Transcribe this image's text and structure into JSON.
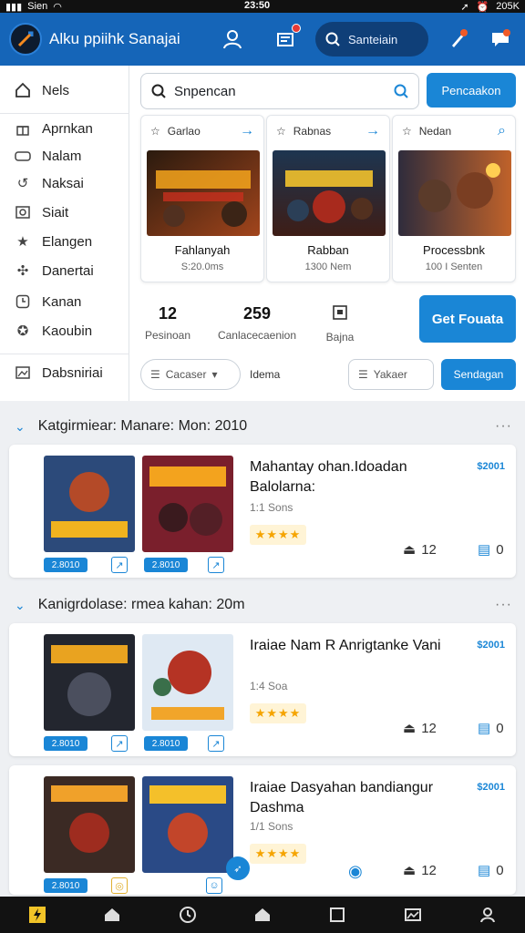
{
  "status": {
    "carrier": "Sien",
    "time": "23:50",
    "battery": "205K"
  },
  "header": {
    "title": "Alku ppiihk Sanajai",
    "search_label": "Santeiain"
  },
  "sidebar": {
    "items": [
      {
        "label": "Nels",
        "icon": "home-icon"
      },
      {
        "label": "Aprnkan",
        "icon": "gift-icon"
      },
      {
        "label": "Nalam",
        "icon": "controller-icon"
      },
      {
        "label": "Naksai",
        "icon": "refresh-icon"
      },
      {
        "label": "Siait",
        "icon": "photo-icon"
      },
      {
        "label": "Elangen",
        "icon": "star-icon"
      },
      {
        "label": "Danertai",
        "icon": "puzzle-icon"
      },
      {
        "label": "Kanan",
        "icon": "clock-icon"
      },
      {
        "label": "Kaoubin",
        "icon": "badge-icon"
      },
      {
        "label": "Dabsniriai",
        "icon": "image-icon"
      }
    ]
  },
  "search": {
    "value": "Snpencan",
    "button": "Pencaakon"
  },
  "featured": [
    {
      "head": "Garlao",
      "name": "Fahlanyah",
      "sub": "S:20.0ms",
      "icon": "arrow-right-icon"
    },
    {
      "head": "Rabnas",
      "name": "Rabban",
      "sub": "1300 Nem",
      "icon": "arrow-right-icon"
    },
    {
      "head": "Nedan",
      "name": "Processbnk",
      "sub": "100 I Senten",
      "icon": "search-icon"
    }
  ],
  "stats": [
    {
      "value": "12",
      "label": "Pesinoan"
    },
    {
      "value": "259",
      "label": "Canlacecaenion"
    },
    {
      "value": "",
      "label": "Bajna"
    }
  ],
  "get_button": "Get Fouata",
  "filters": {
    "sort": "Cacaser",
    "plain": "Idema",
    "view": "Yakaer",
    "blue": "Sendagan"
  },
  "sections": [
    {
      "title": "Katgirmiear: Manare: Mon: 2010",
      "more": "···"
    },
    {
      "title": "Kanigrdolase: rmea kahan: 20m",
      "more": "···"
    }
  ],
  "entries": [
    {
      "title": "Mahantay ohan.Idoadan Balolarna:",
      "meta": "1:1 Sons",
      "rating": "★★★★",
      "price": "$2001",
      "count1": "12",
      "count2": "0",
      "tags": [
        "2.8010",
        "2.8010"
      ]
    },
    {
      "title": "Iraiae Nam R Anrigtanke Vani",
      "meta": "1:4 Soa",
      "rating": "★★★★",
      "price": "$2001",
      "count1": "12",
      "count2": "0",
      "tags": [
        "2.8010",
        "2.8010"
      ]
    },
    {
      "title": "Iraiae Dasyahan bandiangur Dashma",
      "meta": "1/1 Sons",
      "rating": "★★★★",
      "price": "$2001",
      "count1": "12",
      "count2": "0",
      "tags": [
        "2.8010"
      ]
    }
  ],
  "colors": {
    "accent": "#1a86d6",
    "header": "#1565b8",
    "rating": "#f5a400"
  }
}
